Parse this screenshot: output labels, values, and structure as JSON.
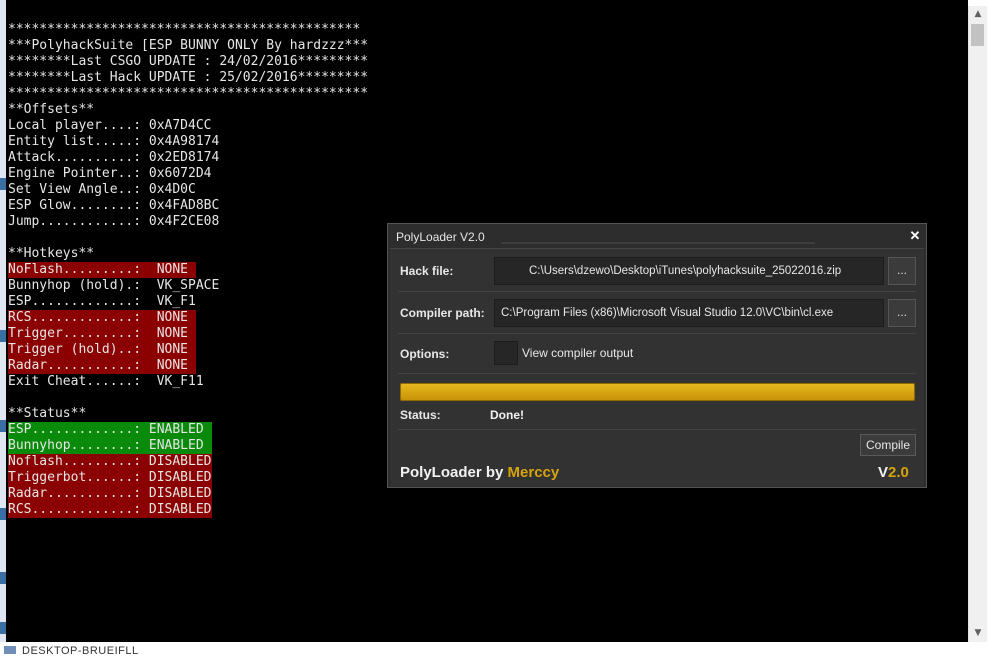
{
  "console": {
    "lines": [
      {
        "text": "*********************************************",
        "hl": ""
      },
      {
        "text": "***PolyhackSuite [ESP BUNNY ONLY By hardzzz***",
        "hl": ""
      },
      {
        "text": "********Last CSGO UPDATE : 24/02/2016*********",
        "hl": ""
      },
      {
        "text": "********Last Hack UPDATE : 25/02/2016*********",
        "hl": ""
      },
      {
        "text": "**********************************************",
        "hl": ""
      },
      {
        "text": "**Offsets**",
        "hl": ""
      },
      {
        "text": "Local player....: 0xA7D4CC",
        "hl": ""
      },
      {
        "text": "Entity list.....: 0x4A98174",
        "hl": ""
      },
      {
        "text": "Attack..........: 0x2ED8174",
        "hl": ""
      },
      {
        "text": "Engine Pointer..: 0x6072D4",
        "hl": ""
      },
      {
        "text": "Set View Angle..: 0x4D0C",
        "hl": ""
      },
      {
        "text": "ESP Glow........: 0x4FAD8BC",
        "hl": ""
      },
      {
        "text": "Jump............: 0x4F2CE08",
        "hl": ""
      },
      {
        "text": "",
        "hl": ""
      },
      {
        "text": "**Hotkeys**",
        "hl": ""
      },
      {
        "text": "NoFlash.........:  NONE ",
        "hl": "red"
      },
      {
        "text": "Bunnyhop (hold).:  VK_SPACE",
        "hl": ""
      },
      {
        "text": "ESP.............:  VK_F1",
        "hl": ""
      },
      {
        "text": "RCS.............:  NONE ",
        "hl": "red"
      },
      {
        "text": "Trigger.........:  NONE ",
        "hl": "red"
      },
      {
        "text": "Trigger (hold)..:  NONE ",
        "hl": "red"
      },
      {
        "text": "Radar...........:  NONE ",
        "hl": "red"
      },
      {
        "text": "Exit Cheat......:  VK_F11",
        "hl": ""
      },
      {
        "text": "",
        "hl": ""
      },
      {
        "text": "**Status**",
        "hl": ""
      },
      {
        "text": "ESP.............: ENABLED ",
        "hl": "green"
      },
      {
        "text": "Bunnyhop........: ENABLED ",
        "hl": "green"
      },
      {
        "text": "Noflash.........: DISABLED",
        "hl": "red"
      },
      {
        "text": "Triggerbot......: DISABLED",
        "hl": "red"
      },
      {
        "text": "Radar...........: DISABLED",
        "hl": "red"
      },
      {
        "text": "RCS.............: DISABLED",
        "hl": "red"
      }
    ]
  },
  "scrollbar": {
    "up_icon": "▲",
    "down_icon": "▼"
  },
  "taskbar": {
    "label": "DESKTOP-BRUEIFLL"
  },
  "loader": {
    "title": "PolyLoader V2.0",
    "close_icon": "✕",
    "hack_file_label": "Hack file:",
    "hack_file_value": "C:\\Users\\dzewo\\Desktop\\iTunes\\polyhacksuite_25022016.zip",
    "compiler_label": "Compiler path:",
    "compiler_value": "C:\\Program Files (x86)\\Microsoft Visual Studio 12.0\\VC\\bin\\cl.exe",
    "browse_label": "...",
    "options_label": "Options:",
    "view_output_label": "View compiler output",
    "progress_percent": 100,
    "status_label": "Status:",
    "status_value": "Done!",
    "compile_label": "Compile",
    "brand_prefix": "PolyLoader by ",
    "brand_author": "Merccy",
    "version_prefix": "V",
    "version_number": "2.0"
  },
  "colors": {
    "accent": "#d6a40a",
    "highlight_red": "#8b0000",
    "highlight_green": "#0a8a0a"
  }
}
